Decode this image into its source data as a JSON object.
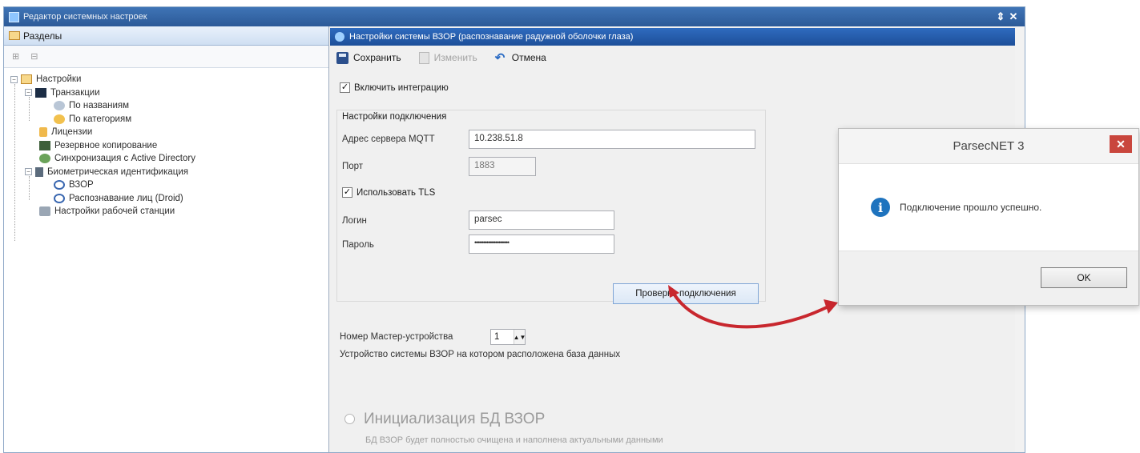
{
  "window": {
    "title": "Редактор системных настроек",
    "pin": "⇕",
    "close": "✕"
  },
  "left_panel": {
    "header": "Разделы",
    "mini_toolbar": [
      "⊞",
      "⊟"
    ],
    "tree": [
      {
        "label": "Настройки",
        "expander": "−"
      },
      {
        "label": "Транзакции",
        "expander": "−"
      },
      {
        "label": "По названиям"
      },
      {
        "label": "По категориям"
      },
      {
        "label": "Лицензии"
      },
      {
        "label": "Резервное копирование"
      },
      {
        "label": "Синхронизация с Active Directory"
      },
      {
        "label": "Биометрическая идентификация",
        "expander": "−"
      },
      {
        "label": "ВЗОР"
      },
      {
        "label": "Распознавание лиц (Droid)"
      },
      {
        "label": "Настройки рабочей станции"
      }
    ]
  },
  "right_panel": {
    "header": "Настройки системы ВЗОР (распознавание радужной оболочки глаза)",
    "toolbar": {
      "save": "Сохранить",
      "edit": "Изменить",
      "cancel": "Отмена"
    },
    "enable_integration": {
      "label": "Включить интеграцию",
      "checked": "✓"
    },
    "connection": {
      "title": "Настройки подключения",
      "server_label": "Адрес сервера MQTT",
      "server_value": "10.238.51.8",
      "port_label": "Порт",
      "port_value": "1883",
      "tls_label": "Использовать TLS",
      "tls_checked": "✓",
      "login_label": "Логин",
      "login_value": "parsec",
      "password_label": "Пароль",
      "password_value": "••••••••••••••••••••",
      "test_button": "Проверка подключения"
    },
    "master_label": "Номер Мастер-устройства",
    "master_value": "1",
    "device_text": "Устройство системы ВЗОР на котором расположена база данных",
    "init": {
      "title": "Инициализация БД ВЗОР",
      "description": "БД ВЗОР будет полностью очищена и наполнена актуальными данными"
    }
  },
  "dialog": {
    "title": "ParsecNET 3",
    "close": "✕",
    "icon": "i",
    "message": "Подключение прошло успешно.",
    "ok": "OK"
  },
  "colors": {
    "accent": "#2c5a98",
    "arrow": "#c8272e",
    "close_button": "#c9463d",
    "info": "#1e73be"
  }
}
